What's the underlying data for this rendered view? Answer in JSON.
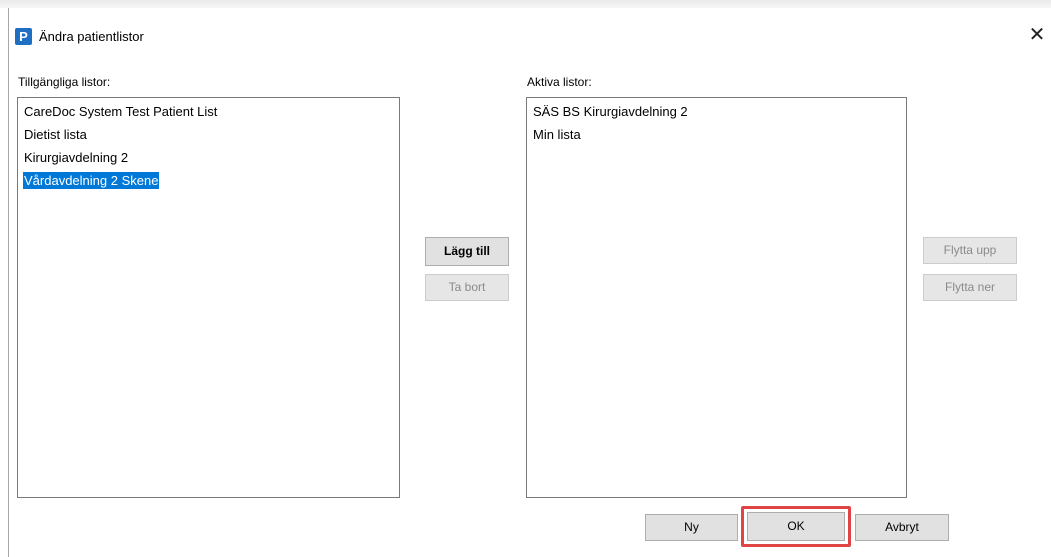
{
  "window": {
    "title": "Ändra patientlistor",
    "app_icon_letter": "P",
    "close_glyph": "✕"
  },
  "available": {
    "label": "Tillgängliga listor:",
    "items": [
      "CareDoc System Test Patient List",
      "Dietist lista",
      "Kirurgiavdelning 2",
      "Vårdavdelning 2 Skene"
    ],
    "selected_item": "Vårdavdelning 2 Skene"
  },
  "active": {
    "label": "Aktiva listor:",
    "items": [
      "SÄS BS Kirurgiavdelning 2",
      "Min lista"
    ]
  },
  "buttons": {
    "add": "Lägg till",
    "remove": "Ta bort",
    "move_up": "Flytta upp",
    "move_down": "Flytta ner",
    "new": "Ny",
    "ok": "OK",
    "cancel": "Avbryt"
  },
  "colors": {
    "selection": "#0078d7",
    "highlight_box": "#e04545",
    "app_icon": "#1e6fc4"
  }
}
